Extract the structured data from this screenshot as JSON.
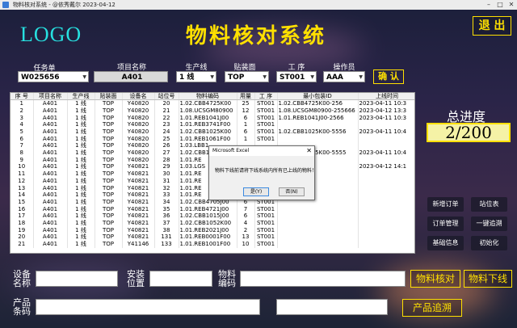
{
  "window": {
    "title": "物料核对系统 - @依秀戴尔 2023-04-12"
  },
  "header": {
    "logo": "LOGO",
    "title": "物料核对系统",
    "exit_label": "退 出"
  },
  "form": {
    "task_label": "任务单",
    "task_value": "W025656",
    "project_label": "项目名称",
    "project_value": "A401",
    "line_label": "生产线",
    "line_value": "1 线",
    "face_label": "贴装面",
    "face_value": "TOP",
    "process_label": "工 序",
    "process_value": "ST001",
    "operator_label": "操作员",
    "operator_value": "AAA",
    "confirm_label": "确 认"
  },
  "table": {
    "columns": [
      "序 号",
      "项目名称",
      "生产线",
      "贴装面",
      "设备名",
      "站位号",
      "物料编码",
      "用量",
      "工 序",
      "最小包装ID",
      "上线时间"
    ],
    "rows": [
      [
        "1",
        "A401",
        "1 线",
        "TOP",
        "Y40820",
        "20",
        "1.02.CBB4725K00",
        "25",
        "ST001",
        "1.02.CBB4725K00-256",
        "2023-04-11 10:3"
      ],
      [
        "2",
        "A401",
        "1 线",
        "TOP",
        "Y40820",
        "21",
        "1.08.UCSGM80900",
        "12",
        "ST001",
        "1.08.UCSGM80900-255666",
        "2023-04-12 13:3"
      ],
      [
        "3",
        "A401",
        "1 线",
        "TOP",
        "Y40820",
        "22",
        "1.01.REB1041J00",
        "6",
        "ST001",
        "1.01.REB1041J00-2566",
        "2023-04-11 10:3"
      ],
      [
        "4",
        "A401",
        "1 线",
        "TOP",
        "Y40820",
        "23",
        "1.01.REB3741F00",
        "1",
        "ST001",
        "",
        ""
      ],
      [
        "5",
        "A401",
        "1 线",
        "TOP",
        "Y40820",
        "24",
        "1.02.CBB1025K00",
        "6",
        "ST001",
        "1.02.CBB1025K00-5556",
        "2023-04-11 10:4"
      ],
      [
        "6",
        "A401",
        "1 线",
        "TOP",
        "Y40820",
        "25",
        "1.01.REB1061F00",
        "1",
        "ST001",
        "",
        ""
      ],
      [
        "7",
        "A401",
        "1 线",
        "TOP",
        "Y40820",
        "26",
        "1.03.LBB1",
        "",
        "",
        "",
        ""
      ],
      [
        "8",
        "A401",
        "1 线",
        "TOP",
        "Y40820",
        "27",
        "1.02.CBB1",
        "",
        "",
        "1.02.CBB1025K00-5555",
        "2023-04-11 10:4"
      ],
      [
        "9",
        "A401",
        "1 线",
        "TOP",
        "Y40820",
        "28",
        "1.01.RE",
        "",
        "",
        "",
        ""
      ],
      [
        "10",
        "A401",
        "1 线",
        "TOP",
        "Y40821",
        "29",
        "1.03.LGS",
        "",
        "",
        "F00-889992",
        "2023-04-12 14:1"
      ],
      [
        "11",
        "A401",
        "1 线",
        "TOP",
        "Y40821",
        "30",
        "1.01.RE",
        "",
        "",
        "",
        ""
      ],
      [
        "12",
        "A401",
        "1 线",
        "TOP",
        "Y40821",
        "31",
        "1.01.RE",
        "",
        "",
        "",
        ""
      ],
      [
        "13",
        "A401",
        "1 线",
        "TOP",
        "Y40821",
        "32",
        "1.01.RE",
        "",
        "",
        "",
        ""
      ],
      [
        "14",
        "A401",
        "1 线",
        "TOP",
        "Y40821",
        "33",
        "1.01.RE",
        "",
        "",
        "",
        ""
      ],
      [
        "15",
        "A401",
        "1 线",
        "TOP",
        "Y40821",
        "34",
        "1.02.CBB4705J00",
        "6",
        "ST001",
        "",
        ""
      ],
      [
        "16",
        "A401",
        "1 线",
        "TOP",
        "Y40821",
        "35",
        "1.01.REB4721J00",
        "7",
        "ST001",
        "",
        ""
      ],
      [
        "17",
        "A401",
        "1 线",
        "TOP",
        "Y40821",
        "36",
        "1.02.CBB1015J00",
        "6",
        "ST001",
        "",
        ""
      ],
      [
        "18",
        "A401",
        "1 线",
        "TOP",
        "Y40821",
        "37",
        "1.02.CBB1052K00",
        "4",
        "ST001",
        "",
        ""
      ],
      [
        "19",
        "A401",
        "1 线",
        "TOP",
        "Y40821",
        "38",
        "1.01.REB2021J00",
        "2",
        "ST001",
        "",
        ""
      ],
      [
        "20",
        "A401",
        "1 线",
        "TOP",
        "Y40821",
        "131",
        "1.01.REB0001F00",
        "13",
        "ST001",
        "",
        ""
      ],
      [
        "21",
        "A401",
        "1 线",
        "TOP",
        "Y41146",
        "133",
        "1.01.REB1001F00",
        "10",
        "ST001",
        "",
        ""
      ]
    ]
  },
  "progress": {
    "title": "总进度",
    "value": "2/200"
  },
  "side_buttons": {
    "new_task": "新增订单",
    "station_table": "站位表",
    "order_mgmt": "订单管理",
    "one_click_trace": "一键追溯",
    "basic_info": "基础信息",
    "init": "初始化"
  },
  "bottom": {
    "device_label": "设备名称",
    "install_label": "安装位置",
    "material_label": "物料编码",
    "product_label": "产品条码",
    "verify_button": "物料核对",
    "offline_button": "物料下线",
    "trace_button": "产品追溯"
  },
  "dialog": {
    "title": "Microsoft Excel",
    "message": "物料下线前请将下线系统内所有已上线的物料！",
    "yes": "是(Y)",
    "no": "否(N)"
  },
  "colors": {
    "accent_yellow": "#ffe000",
    "logo_cyan": "#27e0e0"
  }
}
